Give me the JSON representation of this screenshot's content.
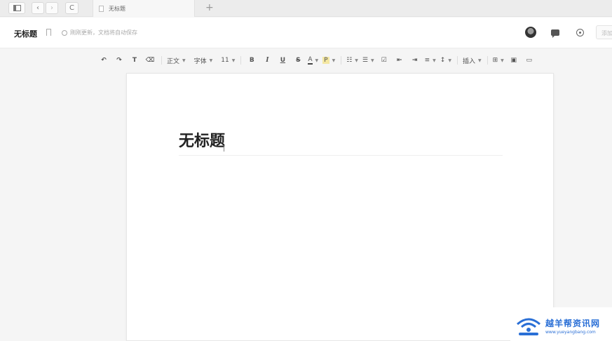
{
  "browser": {
    "tab_title": "无标题",
    "new_tab": "+",
    "back": "‹",
    "forward": "›",
    "reload": "C"
  },
  "header": {
    "title": "无标题",
    "save_status": "刚刚更新，文档将自动保存",
    "add_label": "添加"
  },
  "toolbar": {
    "paragraph_style": "正文",
    "font_family": "字体",
    "font_size": "11",
    "bold": "B",
    "italic": "I",
    "underline": "U",
    "strike": "S",
    "font_color": "A",
    "highlight": "P",
    "insert": "插入"
  },
  "document": {
    "heading": "无标题"
  },
  "watermark": {
    "name": "越羊帮资讯网",
    "url": "www.yueyangbang.com"
  }
}
